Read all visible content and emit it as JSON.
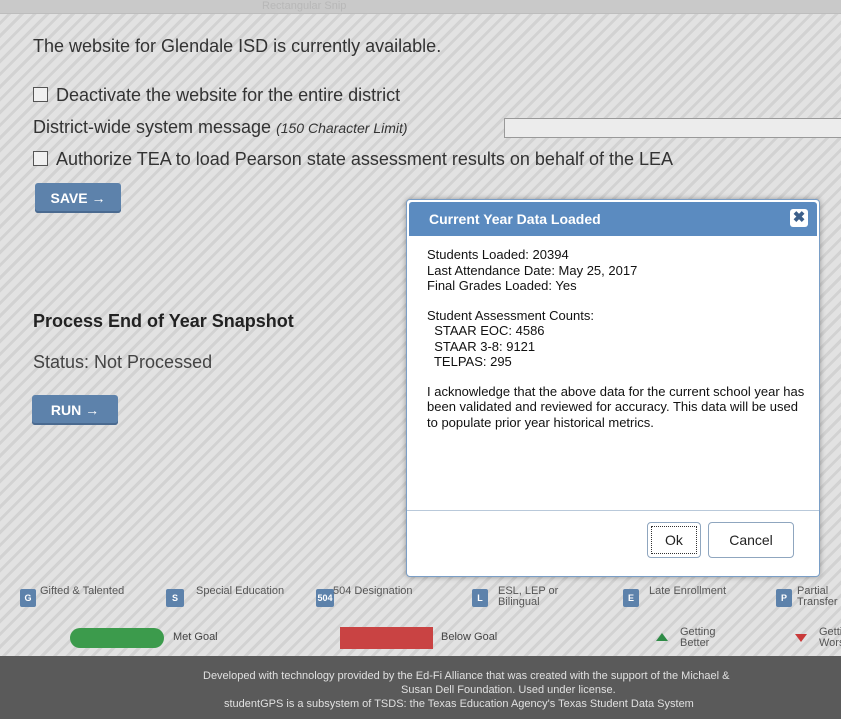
{
  "top_bar": {
    "ghost_text": "Rectangular Snip"
  },
  "status_text": "The website for Glendale ISD is currently available.",
  "deactivate_label": "Deactivate the website for the entire district",
  "message": {
    "label": "District-wide system message ",
    "limit": "(150 Character Limit)",
    "value": ""
  },
  "authorize_label": "Authorize TEA to load Pearson state assessment results on behalf of the LEA",
  "save_label": "SAVE →",
  "snapshot": {
    "heading": "Process End of Year Snapshot",
    "status": "Status: Not Processed",
    "run_label": "RUN →"
  },
  "modal": {
    "title": "Current Year Data Loaded",
    "close_glyph": "✖",
    "lines": [
      "Students Loaded: 20394",
      "Last Attendance Date: May 25, 2017",
      "Final Grades Loaded: Yes"
    ],
    "counts_heading": "Student Assessment Counts:",
    "counts": [
      "  STAAR EOC: 4586",
      "  STAAR 3-8: 9121",
      "  TELPAS: 295"
    ],
    "acknowledgement": "I acknowledge that the above data for the current school year has been validated and reviewed for accuracy. This data will be used to populate prior year historical metrics.",
    "ok_label": "Ok",
    "cancel_label": "Cancel"
  },
  "legend": {
    "items": [
      {
        "icon": "G",
        "label": "Gifted & Talented"
      },
      {
        "icon": "S",
        "label": "Special Education"
      },
      {
        "icon": "504",
        "label": "504 Designation"
      },
      {
        "icon": "L",
        "label": "ESL, LEP or Bilingual"
      },
      {
        "icon": "E",
        "label": "Late Enrollment"
      },
      {
        "icon": "P",
        "label": "Partial Transfer"
      }
    ],
    "met_goal": "Met Goal",
    "below_goal": "Below Goal",
    "getting_better": "Getting Better",
    "getting_worse": "Getting Worse"
  },
  "footer": {
    "line1": "Developed with technology provided by the Ed-Fi Alliance that was created with the support of the Michael &",
    "line2": "Susan Dell Foundation. Used under license.",
    "line3": "studentGPS is a subsystem of TSDS: the Texas Education Agency's Texas Student Data System"
  },
  "colors": {
    "accent": "#5d82ab",
    "modal_header": "#5b8bc0",
    "met_goal": "#3c9b4c",
    "below_goal": "#c94343",
    "footer": "#5a5a5a"
  }
}
